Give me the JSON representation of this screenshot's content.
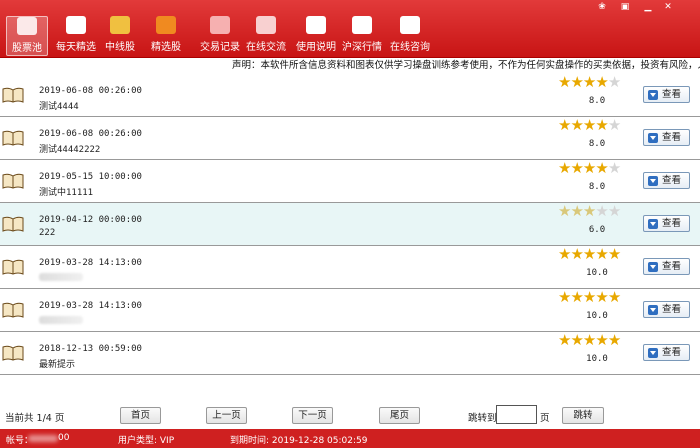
{
  "toolbar": {
    "items": [
      {
        "label": "股票池",
        "icon": "mail-icon",
        "active": true
      },
      {
        "label": "每天精选",
        "icon": "document-icon"
      },
      {
        "label": "中线股",
        "icon": "book-icon"
      },
      {
        "label": "精选股",
        "icon": "rss-icon"
      },
      {
        "label": "交易记录",
        "icon": "pen-icon"
      },
      {
        "label": "在线交流",
        "icon": "chat-icon"
      },
      {
        "label": "使用说明",
        "icon": "person-icon"
      },
      {
        "label": "沪深行情",
        "icon": "chart-icon"
      },
      {
        "label": "在线咨询",
        "icon": "support-icon"
      }
    ],
    "accent": "#d32020"
  },
  "disclaimer": "声明：本软件所含信息资料和图表仅供学习操盘训练参考使用，不作为任何实盘操作的买卖依据，投资有风险，入市需谨",
  "rows": [
    {
      "date": "2019-06-08 00:26:00",
      "title": "测试4444",
      "stars": 4,
      "score": "8.0",
      "button": "查看"
    },
    {
      "date": "2019-06-08 00:26:00",
      "title": "测试44442222",
      "stars": 4,
      "score": "8.0",
      "button": "查看"
    },
    {
      "date": "2019-05-15 10:00:00",
      "title": "测试中11111",
      "stars": 4,
      "score": "8.0",
      "button": "查看"
    },
    {
      "date": "2019-04-12 00:00:00",
      "title": "222",
      "stars": 3,
      "score": "6.0",
      "button": "查看",
      "selected": true
    },
    {
      "date": "2019-03-28 14:13:00",
      "title": "",
      "stars": 5,
      "score": "10.0",
      "button": "查看"
    },
    {
      "date": "2019-03-28 14:13:00",
      "title": "",
      "stars": 5,
      "score": "10.0",
      "button": "查看"
    },
    {
      "date": "2018-12-13 00:59:00",
      "title": "最新提示",
      "stars": 5,
      "score": "10.0",
      "button": "查看"
    }
  ],
  "pager": {
    "info": "当前共 1/4 页",
    "first": "首页",
    "prev": "上一页",
    "next": "下一页",
    "last": "尾页",
    "jump_label": "跳转到",
    "jump_value": "",
    "jump_unit": "页",
    "jump_button": "跳转"
  },
  "status": {
    "account_label": "帐号：",
    "account_suffix": "00",
    "user_type": "用户类型: VIP",
    "expiry": "到期时间: 2019-12-28 05:02:59"
  }
}
